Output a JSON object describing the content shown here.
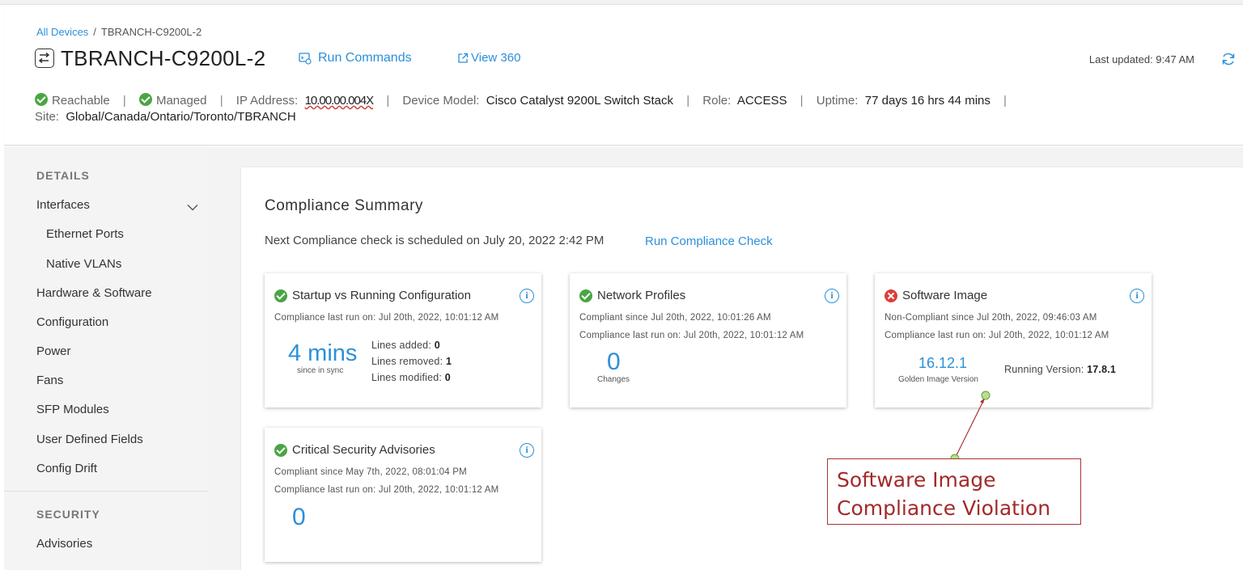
{
  "breadcrumb": {
    "root": "All Devices",
    "separator": "/",
    "current": "TBRANCH-C9200L-2"
  },
  "device": {
    "title": "TBRANCH-C9200L-2"
  },
  "actions": {
    "run_commands": "Run Commands",
    "view_360": "View 360"
  },
  "last_updated": "Last updated: 9:47 AM",
  "status": {
    "reachable": "Reachable",
    "managed": "Managed",
    "ip_label": "IP Address:",
    "ip_value": "10.00.00.004X",
    "model_label": "Device Model:",
    "model_value": "Cisco Catalyst 9200L Switch Stack",
    "role_label": "Role:",
    "role_value": "ACCESS",
    "uptime_label": "Uptime:",
    "uptime_value": "77 days 16 hrs 44 mins",
    "site_label": "Site:",
    "site_value": "Global/Canada/Ontario/Toronto/TBRANCH",
    "pipe": "|"
  },
  "sidebar": {
    "details_heading": "DETAILS",
    "interfaces": "Interfaces",
    "ethernet_ports": "Ethernet Ports",
    "native_vlans": "Native VLANs",
    "hardware_software": "Hardware & Software",
    "configuration": "Configuration",
    "power": "Power",
    "fans": "Fans",
    "sfp_modules": "SFP Modules",
    "user_defined_fields": "User Defined Fields",
    "config_drift": "Config Drift",
    "security_heading": "SECURITY",
    "advisories": "Advisories"
  },
  "compliance": {
    "title": "Compliance Summary",
    "next_check": "Next Compliance check is scheduled on July 20, 2022 2:42 PM",
    "run_check": "Run Compliance Check",
    "info_glyph": "i",
    "cards": {
      "startup": {
        "title": "Startup vs Running Configuration",
        "meta1": "Compliance last run on: Jul 20th, 2022, 10:01:12 AM",
        "big": "4 mins",
        "caption": "since in sync",
        "lines_added_label": "Lines added:",
        "lines_added": "0",
        "lines_removed_label": "Lines removed:",
        "lines_removed": "1",
        "lines_modified_label": "Lines modified:",
        "lines_modified": "0"
      },
      "network": {
        "title": "Network Profiles",
        "meta1": "Compliant since Jul 20th, 2022, 10:01:26 AM",
        "meta2": "Compliance last run on: Jul 20th, 2022, 10:01:12 AM",
        "big": "0",
        "caption": "Changes"
      },
      "software": {
        "title": "Software Image",
        "meta1": "Non-Compliant since Jul 20th, 2022, 09:46:03 AM",
        "meta2": "Compliance last run on: Jul 20th, 2022, 10:01:12 AM",
        "golden_version": "16.12.1",
        "golden_caption": "Golden Image Version",
        "running_label": "Running Version:",
        "running_value": "17.8.1"
      },
      "security": {
        "title": "Critical Security Advisories",
        "meta1": "Compliant since May 7th, 2022, 08:01:04 PM",
        "meta2": "Compliance last run on: Jul 20th, 2022, 10:01:12 AM",
        "big": "0"
      }
    }
  },
  "annotation": {
    "line1": "Software Image",
    "line2": "Compliance Violation"
  },
  "colors": {
    "link": "#2b90d9",
    "ok": "#4aa543",
    "error": "#d9403a",
    "annotation": "#a32a2a"
  },
  "icons": [
    "device-switch-icon",
    "run-commands-icon",
    "external-link-icon",
    "refresh-icon",
    "check-circle-icon",
    "x-circle-icon",
    "info-icon",
    "chevron-down-icon"
  ]
}
